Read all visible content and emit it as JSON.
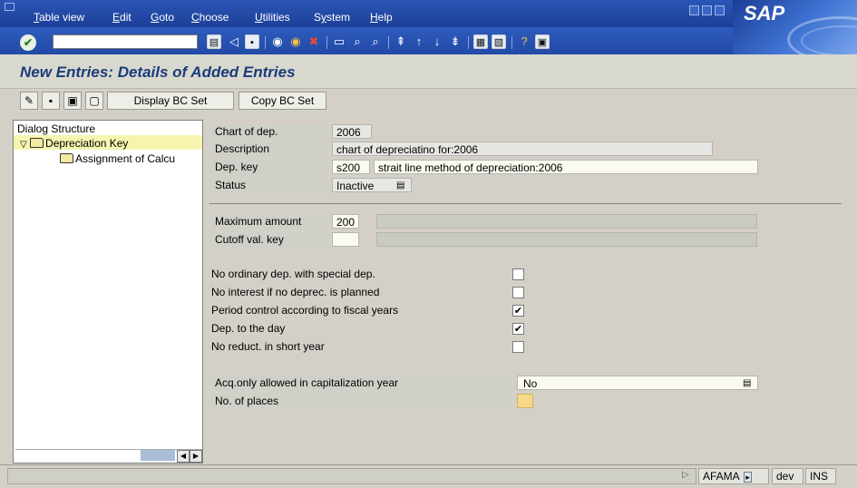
{
  "menu": [
    "Table view",
    "Edit",
    "Goto",
    "Choose",
    "Utilities",
    "System",
    "Help"
  ],
  "menu_underline": [
    "T",
    "E",
    "G",
    "C",
    "U",
    "y",
    "H"
  ],
  "brand": "SAP",
  "command_field": {
    "value": ""
  },
  "page_title": "New Entries: Details of Added Entries",
  "app_toolbar": {
    "display_bc_set": "Display BC Set",
    "copy_bc_set": "Copy BC Set"
  },
  "tree": {
    "header": "Dialog Structure",
    "items": [
      {
        "label": "Depreciation Key",
        "selected": true,
        "expanded": true
      },
      {
        "label": "Assignment of Calcu",
        "selected": false
      }
    ]
  },
  "form": {
    "chart_of_dep": {
      "label": "Chart of dep.",
      "value": "2006"
    },
    "description": {
      "label": "Description",
      "value": "chart of depreciatino for:2006"
    },
    "dep_key": {
      "label": "Dep. key",
      "value": "s200",
      "text": "strait line method of depreciation:2006"
    },
    "status": {
      "label": "Status",
      "value": "Inactive"
    },
    "max_amount": {
      "label": "Maximum amount",
      "value": "200",
      "text": ""
    },
    "cutoff_val_key": {
      "label": "Cutoff val. key",
      "value": "",
      "text": ""
    },
    "checkboxes": [
      {
        "label": "No ordinary dep. with special dep.",
        "checked": false
      },
      {
        "label": "No interest if no deprec. is planned",
        "checked": false
      },
      {
        "label": "Period control according to fiscal years",
        "checked": true
      },
      {
        "label": "Dep. to the day",
        "checked": true
      },
      {
        "label": "No reduct. in short year",
        "checked": false
      }
    ],
    "acq_only": {
      "label": "Acq.only allowed in capitalization year",
      "value": "No"
    },
    "no_of_places": {
      "label": "No. of places",
      "value": ""
    }
  },
  "status_bar": {
    "system": "AFAMA",
    "client": "dev",
    "mode": "INS"
  },
  "colors": {
    "menubar": "#2a56b8",
    "title_text": "#1b3b7a",
    "tree_selection": "#f5f5b0",
    "required_field": "#f5d88a"
  }
}
